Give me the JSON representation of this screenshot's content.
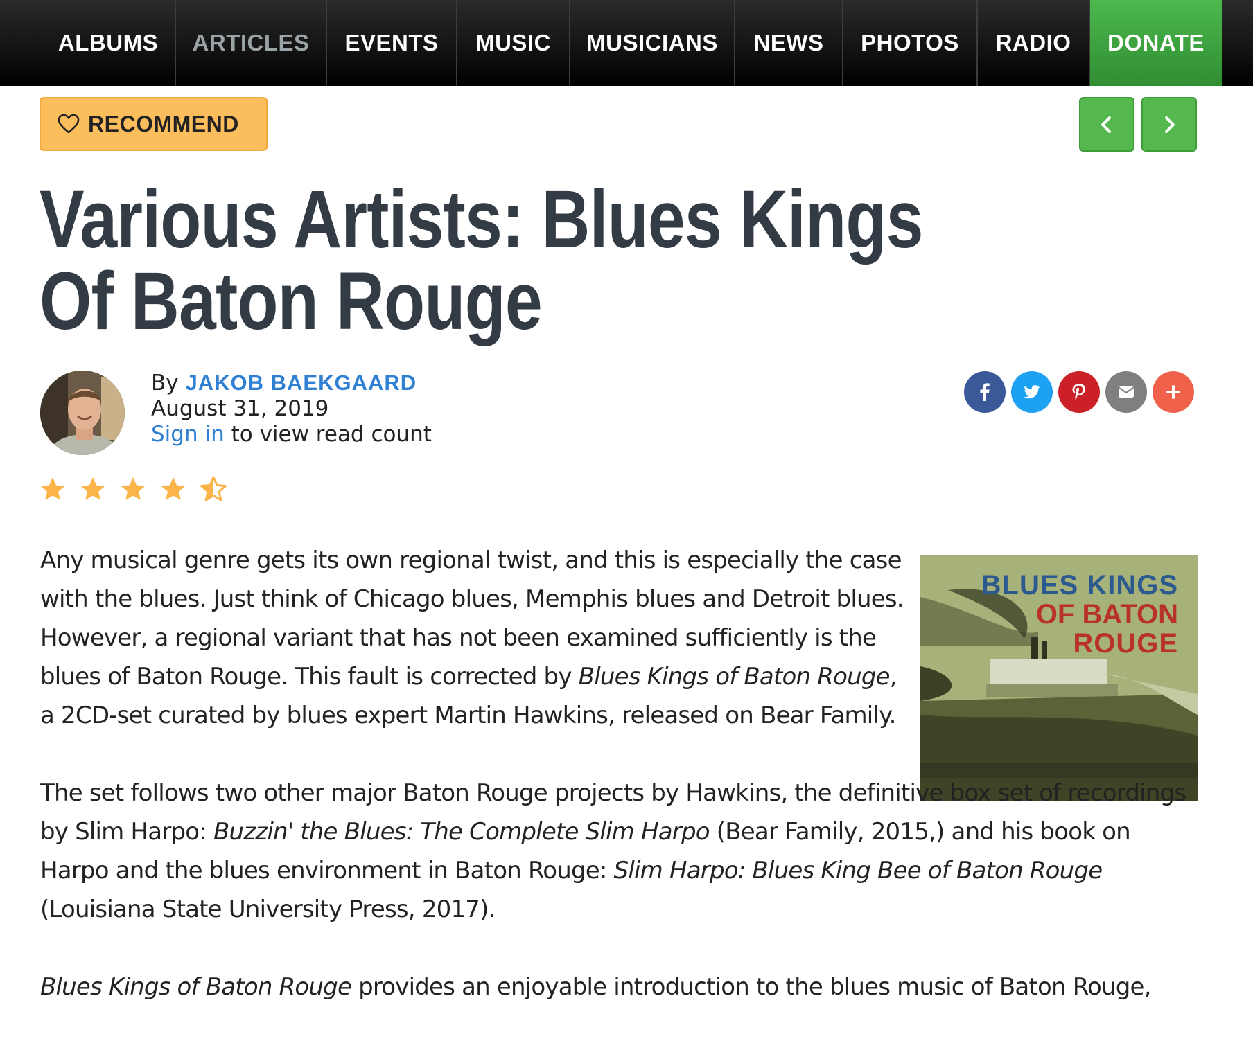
{
  "nav": {
    "items": [
      "ALBUMS",
      "ARTICLES",
      "EVENTS",
      "MUSIC",
      "MUSICIANS",
      "NEWS",
      "PHOTOS",
      "RADIO",
      "DONATE"
    ],
    "active": "ARTICLES",
    "donate_color": "#3aa03c"
  },
  "toolbar": {
    "recommend_label": "RECOMMEND",
    "recommend_icon": "heart-icon",
    "prev_icon": "chevron-left-icon",
    "next_icon": "chevron-right-icon"
  },
  "article": {
    "title": "Various Artists: Blues Kings Of Baton Rouge",
    "by_prefix": "By",
    "author": "JAKOB BAEKGAARD",
    "date": "August 31, 2019",
    "sign_in_link": "Sign in",
    "sign_in_suffix": " to view read count",
    "rating": 4.5,
    "rating_max": 5,
    "share_icons": [
      {
        "name": "facebook-icon",
        "color": "#3b5998"
      },
      {
        "name": "twitter-icon",
        "color": "#1da1f2"
      },
      {
        "name": "pinterest-icon",
        "color": "#cb2027"
      },
      {
        "name": "email-icon",
        "color": "#7f7f7f"
      },
      {
        "name": "plus-icon",
        "color": "#f0614b"
      }
    ],
    "cover": {
      "line1": "BLUES KINGS",
      "line2": "OF BATON",
      "line3": "ROUGE"
    },
    "p1": {
      "t1": "Any musical genre gets its own regional twist, and this is especially the case with the blues. Just think of Chicago blues, Memphis blues and Detroit blues. However, a regional variant that has not been examined sufficiently is the blues of Baton Rouge. This fault is corrected by ",
      "i1": "Blues Kings of Baton Rouge",
      "t2": ", a 2CD-set curated by blues expert Martin Hawkins, released on Bear Family."
    },
    "p2": {
      "t1": "The set follows two other major Baton Rouge projects by Hawkins, the definitive box set of recordings by Slim Harpo: ",
      "i1": "Buzzin' the Blues: The Complete Slim Harpo",
      "t2": " (Bear Family, 2015,) and his book on Harpo and the blues environment in Baton Rouge: ",
      "i2": "Slim Harpo: Blues King Bee of Baton Rouge",
      "t3": " (Louisiana State University Press, 2017)."
    },
    "p3": {
      "i1": "Blues Kings of Baton Rouge",
      "t1": " provides an enjoyable introduction to the blues music of Baton Rouge,"
    }
  }
}
